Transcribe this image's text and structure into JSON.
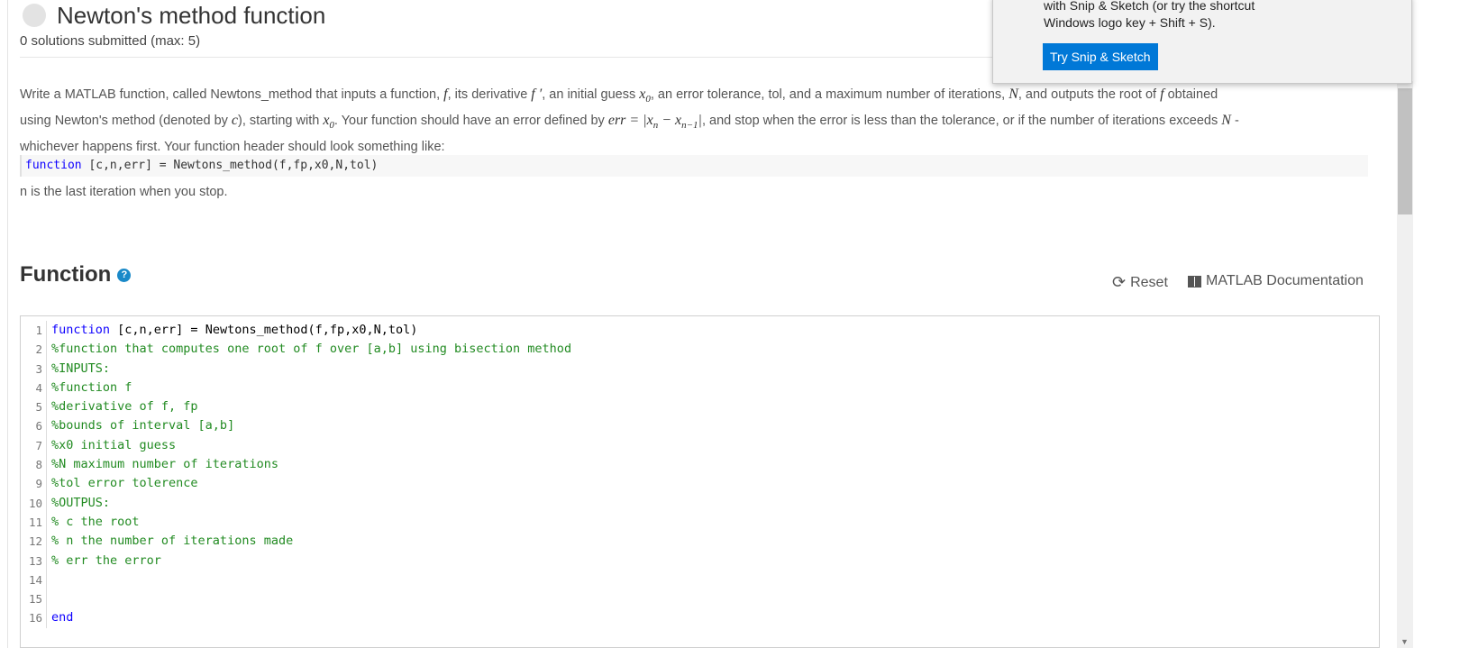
{
  "problem": {
    "title": "Newton's method function",
    "submissions": "0 solutions submitted (max: 5)",
    "description": {
      "p1": "Write a MATLAB function, called Newtons_method that inputs a function,",
      "p2": ", its derivative",
      "p3": ", an initial guess",
      "p4": ", an error tolerance, tol, and a maximum number of iterations,",
      "p5": ", and outputs the root of",
      "p6": "obtained",
      "p7": "using Newton's method (denoted by",
      "p8": "), starting with",
      "p9": ". Your function should have an error defined by",
      "p10": ", and stop when the error is less than the tolerance, or if the number of iterations exceeds",
      "p11": "-",
      "p12": "whichever happens first. Your function header should look something like:",
      "m_f": "f",
      "m_fp": "f ′",
      "m_x0": "x",
      "m_x0_sub": "0",
      "m_N": "N",
      "m_c": "c",
      "m_err": "err = |x",
      "m_err_sub1": "n",
      "m_err_mid": " − x",
      "m_err_sub2": "n−1",
      "m_err_end": "|"
    },
    "header_code": {
      "keyword": "function",
      "rest": " [c,n,err] = Newtons_method(f,fp,x0,N,tol)"
    },
    "after_code": "n is the last iteration when you stop."
  },
  "function_section": {
    "heading": "Function",
    "help_icon": "?",
    "reset_label": "Reset",
    "doc_label": "MATLAB Documentation"
  },
  "editor": {
    "lines": [
      {
        "num": "1",
        "kw": "function",
        "text": " [c,n,err] = Newtons_method(f,fp,x0,N,tol)",
        "type": "code"
      },
      {
        "num": "2",
        "text": "%function that computes one root of f over [a,b] using bisection method",
        "type": "comment"
      },
      {
        "num": "3",
        "text": "%INPUTS:",
        "type": "comment"
      },
      {
        "num": "4",
        "text": "%function f",
        "type": "comment"
      },
      {
        "num": "5",
        "text": "%derivative of f, fp",
        "type": "comment"
      },
      {
        "num": "6",
        "text": "%bounds of interval [a,b]",
        "type": "comment"
      },
      {
        "num": "7",
        "text": "%x0 initial guess",
        "type": "comment"
      },
      {
        "num": "8",
        "text": "%N maximum number of iterations",
        "type": "comment"
      },
      {
        "num": "9",
        "text": "%tol error tolerence",
        "type": "comment"
      },
      {
        "num": "10",
        "text": "%OUTPUS:",
        "type": "comment"
      },
      {
        "num": "11",
        "text": "% c the root",
        "type": "comment"
      },
      {
        "num": "12",
        "text": "% n the number of iterations made",
        "type": "comment"
      },
      {
        "num": "13",
        "text": "% err the error",
        "type": "comment"
      },
      {
        "num": "14",
        "text": "",
        "type": "comment"
      },
      {
        "num": "15",
        "text": "",
        "type": "comment"
      },
      {
        "num": "16",
        "kw": "end",
        "text": "",
        "type": "code"
      }
    ]
  },
  "popup": {
    "line1": "with Snip & Sketch (or try the shortcut",
    "line2": "Windows logo key + Shift + S).",
    "button": "Try Snip & Sketch"
  },
  "colors": {
    "keyword": "#0e00ff",
    "comment": "#228b22",
    "accent": "#0078d7"
  }
}
